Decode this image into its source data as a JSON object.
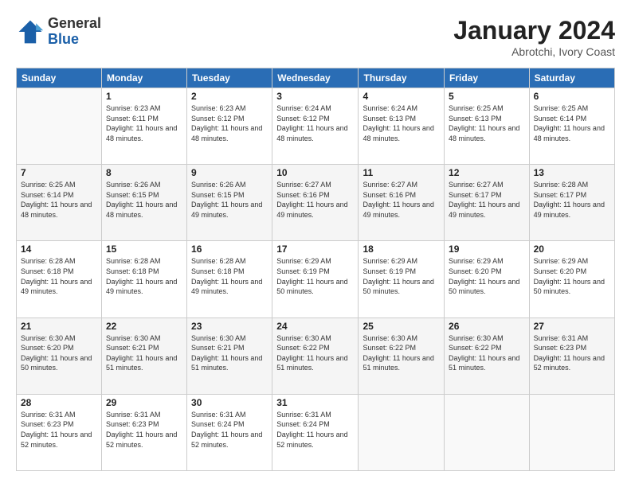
{
  "logo": {
    "general": "General",
    "blue": "Blue"
  },
  "header": {
    "title": "January 2024",
    "subtitle": "Abrotchi, Ivory Coast"
  },
  "columns": [
    "Sunday",
    "Monday",
    "Tuesday",
    "Wednesday",
    "Thursday",
    "Friday",
    "Saturday"
  ],
  "weeks": [
    [
      {
        "day": "",
        "sunrise": "",
        "sunset": "",
        "daylight": ""
      },
      {
        "day": "1",
        "sunrise": "Sunrise: 6:23 AM",
        "sunset": "Sunset: 6:11 PM",
        "daylight": "Daylight: 11 hours and 48 minutes."
      },
      {
        "day": "2",
        "sunrise": "Sunrise: 6:23 AM",
        "sunset": "Sunset: 6:12 PM",
        "daylight": "Daylight: 11 hours and 48 minutes."
      },
      {
        "day": "3",
        "sunrise": "Sunrise: 6:24 AM",
        "sunset": "Sunset: 6:12 PM",
        "daylight": "Daylight: 11 hours and 48 minutes."
      },
      {
        "day": "4",
        "sunrise": "Sunrise: 6:24 AM",
        "sunset": "Sunset: 6:13 PM",
        "daylight": "Daylight: 11 hours and 48 minutes."
      },
      {
        "day": "5",
        "sunrise": "Sunrise: 6:25 AM",
        "sunset": "Sunset: 6:13 PM",
        "daylight": "Daylight: 11 hours and 48 minutes."
      },
      {
        "day": "6",
        "sunrise": "Sunrise: 6:25 AM",
        "sunset": "Sunset: 6:14 PM",
        "daylight": "Daylight: 11 hours and 48 minutes."
      }
    ],
    [
      {
        "day": "7",
        "sunrise": "Sunrise: 6:25 AM",
        "sunset": "Sunset: 6:14 PM",
        "daylight": "Daylight: 11 hours and 48 minutes."
      },
      {
        "day": "8",
        "sunrise": "Sunrise: 6:26 AM",
        "sunset": "Sunset: 6:15 PM",
        "daylight": "Daylight: 11 hours and 48 minutes."
      },
      {
        "day": "9",
        "sunrise": "Sunrise: 6:26 AM",
        "sunset": "Sunset: 6:15 PM",
        "daylight": "Daylight: 11 hours and 49 minutes."
      },
      {
        "day": "10",
        "sunrise": "Sunrise: 6:27 AM",
        "sunset": "Sunset: 6:16 PM",
        "daylight": "Daylight: 11 hours and 49 minutes."
      },
      {
        "day": "11",
        "sunrise": "Sunrise: 6:27 AM",
        "sunset": "Sunset: 6:16 PM",
        "daylight": "Daylight: 11 hours and 49 minutes."
      },
      {
        "day": "12",
        "sunrise": "Sunrise: 6:27 AM",
        "sunset": "Sunset: 6:17 PM",
        "daylight": "Daylight: 11 hours and 49 minutes."
      },
      {
        "day": "13",
        "sunrise": "Sunrise: 6:28 AM",
        "sunset": "Sunset: 6:17 PM",
        "daylight": "Daylight: 11 hours and 49 minutes."
      }
    ],
    [
      {
        "day": "14",
        "sunrise": "Sunrise: 6:28 AM",
        "sunset": "Sunset: 6:18 PM",
        "daylight": "Daylight: 11 hours and 49 minutes."
      },
      {
        "day": "15",
        "sunrise": "Sunrise: 6:28 AM",
        "sunset": "Sunset: 6:18 PM",
        "daylight": "Daylight: 11 hours and 49 minutes."
      },
      {
        "day": "16",
        "sunrise": "Sunrise: 6:28 AM",
        "sunset": "Sunset: 6:18 PM",
        "daylight": "Daylight: 11 hours and 49 minutes."
      },
      {
        "day": "17",
        "sunrise": "Sunrise: 6:29 AM",
        "sunset": "Sunset: 6:19 PM",
        "daylight": "Daylight: 11 hours and 50 minutes."
      },
      {
        "day": "18",
        "sunrise": "Sunrise: 6:29 AM",
        "sunset": "Sunset: 6:19 PM",
        "daylight": "Daylight: 11 hours and 50 minutes."
      },
      {
        "day": "19",
        "sunrise": "Sunrise: 6:29 AM",
        "sunset": "Sunset: 6:20 PM",
        "daylight": "Daylight: 11 hours and 50 minutes."
      },
      {
        "day": "20",
        "sunrise": "Sunrise: 6:29 AM",
        "sunset": "Sunset: 6:20 PM",
        "daylight": "Daylight: 11 hours and 50 minutes."
      }
    ],
    [
      {
        "day": "21",
        "sunrise": "Sunrise: 6:30 AM",
        "sunset": "Sunset: 6:20 PM",
        "daylight": "Daylight: 11 hours and 50 minutes."
      },
      {
        "day": "22",
        "sunrise": "Sunrise: 6:30 AM",
        "sunset": "Sunset: 6:21 PM",
        "daylight": "Daylight: 11 hours and 51 minutes."
      },
      {
        "day": "23",
        "sunrise": "Sunrise: 6:30 AM",
        "sunset": "Sunset: 6:21 PM",
        "daylight": "Daylight: 11 hours and 51 minutes."
      },
      {
        "day": "24",
        "sunrise": "Sunrise: 6:30 AM",
        "sunset": "Sunset: 6:22 PM",
        "daylight": "Daylight: 11 hours and 51 minutes."
      },
      {
        "day": "25",
        "sunrise": "Sunrise: 6:30 AM",
        "sunset": "Sunset: 6:22 PM",
        "daylight": "Daylight: 11 hours and 51 minutes."
      },
      {
        "day": "26",
        "sunrise": "Sunrise: 6:30 AM",
        "sunset": "Sunset: 6:22 PM",
        "daylight": "Daylight: 11 hours and 51 minutes."
      },
      {
        "day": "27",
        "sunrise": "Sunrise: 6:31 AM",
        "sunset": "Sunset: 6:23 PM",
        "daylight": "Daylight: 11 hours and 52 minutes."
      }
    ],
    [
      {
        "day": "28",
        "sunrise": "Sunrise: 6:31 AM",
        "sunset": "Sunset: 6:23 PM",
        "daylight": "Daylight: 11 hours and 52 minutes."
      },
      {
        "day": "29",
        "sunrise": "Sunrise: 6:31 AM",
        "sunset": "Sunset: 6:23 PM",
        "daylight": "Daylight: 11 hours and 52 minutes."
      },
      {
        "day": "30",
        "sunrise": "Sunrise: 6:31 AM",
        "sunset": "Sunset: 6:24 PM",
        "daylight": "Daylight: 11 hours and 52 minutes."
      },
      {
        "day": "31",
        "sunrise": "Sunrise: 6:31 AM",
        "sunset": "Sunset: 6:24 PM",
        "daylight": "Daylight: 11 hours and 52 minutes."
      },
      {
        "day": "",
        "sunrise": "",
        "sunset": "",
        "daylight": ""
      },
      {
        "day": "",
        "sunrise": "",
        "sunset": "",
        "daylight": ""
      },
      {
        "day": "",
        "sunrise": "",
        "sunset": "",
        "daylight": ""
      }
    ]
  ]
}
